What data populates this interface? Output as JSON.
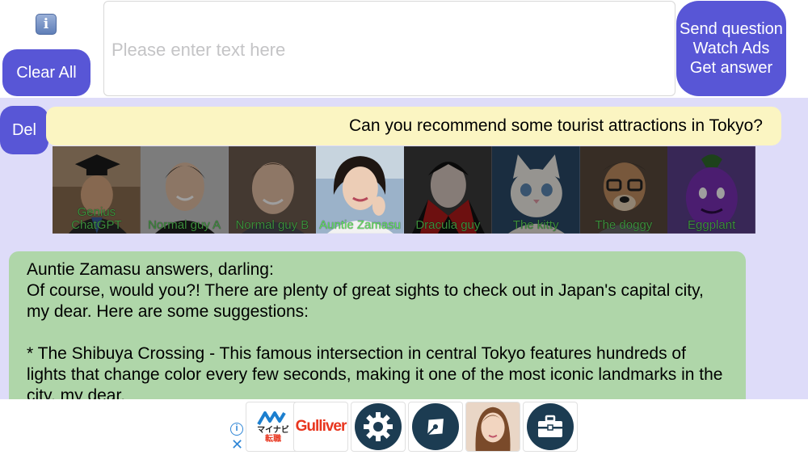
{
  "header": {
    "info_icon_glyph": "i",
    "clear_all_label": "Clear All",
    "input_placeholder": "Please enter text here",
    "input_value": "",
    "send_lines": [
      "Send question",
      "Watch Ads",
      "Get answer"
    ]
  },
  "chat": {
    "del_label": "Del",
    "question": "Can you recommend some tourist attractions in Tokyo?",
    "characters": [
      {
        "name": "Genius ChatGPT",
        "icon": "graduate-avatar",
        "selected": false
      },
      {
        "name": "Normal guy A",
        "icon": "young-man-avatar",
        "selected": false
      },
      {
        "name": "Normal guy B",
        "icon": "smiling-man-avatar",
        "selected": false
      },
      {
        "name": "Auntie Zamasu",
        "icon": "auntie-avatar",
        "selected": true
      },
      {
        "name": "Dracula guy",
        "icon": "dracula-avatar",
        "selected": false
      },
      {
        "name": "The kitty",
        "icon": "kitty-avatar",
        "selected": false
      },
      {
        "name": "The doggy",
        "icon": "doggy-avatar",
        "selected": false
      },
      {
        "name": "Eggplant",
        "icon": "eggplant-avatar",
        "selected": false
      }
    ],
    "answer": {
      "heading": "Auntie Zamasu answers, darling:",
      "para1": "Of course, would you?! There are plenty of great sights to check out in Japan's capital city, my dear. Here are some suggestions:",
      "para2": "* The Shibuya Crossing - This famous intersection in central Tokyo features hundreds of lights that change color every few seconds, making it one of the most iconic landmarks in the city, my dear."
    }
  },
  "ads": {
    "info_glyph": "i",
    "close_glyph": "✕",
    "tiles": [
      {
        "name": "mynavi",
        "text_line1": "マイナビ",
        "text_line2": "転職"
      },
      {
        "name": "gulliver",
        "text": "Gulliver"
      },
      {
        "name": "settings-app",
        "icon": "gear-icon"
      },
      {
        "name": "pen-app",
        "icon": "pen-nib-icon"
      },
      {
        "name": "photo-app",
        "icon": "woman-photo"
      },
      {
        "name": "briefcase-app",
        "icon": "briefcase-icon"
      }
    ]
  },
  "colors": {
    "accent": "#5856d6",
    "chat_bg": "#dedcf9",
    "question_bg": "#fbf5c2",
    "answer_bg": "#afd6a9",
    "name_green": "#5fe05f"
  }
}
